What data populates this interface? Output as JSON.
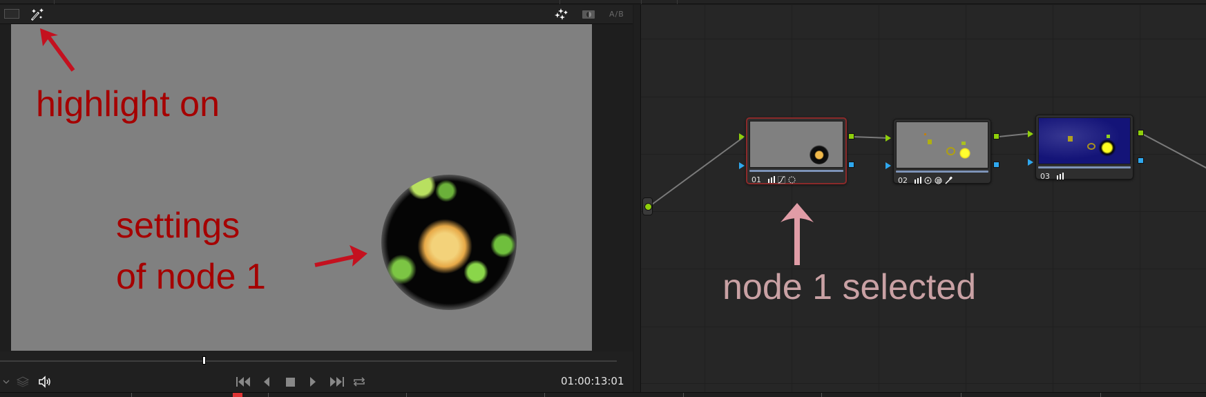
{
  "viewer": {
    "toolbar": {
      "grid_icon": "viewer-grid-icon",
      "highlight_icon": "magic-wand-highlight-icon",
      "effects_icon": "sparkle-icon",
      "split_icon": "split-screen-icon",
      "ab_label": "A/B"
    },
    "annotations": {
      "highlight": "highlight on",
      "settings_line1": "settings",
      "settings_line2": "of node 1"
    },
    "transport": {
      "timecode": "01:00:13:01",
      "buttons": [
        "go-to-start",
        "step-back",
        "stop",
        "play",
        "go-to-end",
        "loop"
      ]
    },
    "annotation_color": "#a50000"
  },
  "node_graph": {
    "nodes": [
      {
        "id": "01",
        "label": "01",
        "selected": true,
        "tools": [
          "primaries-bars",
          "curves",
          "window-circle"
        ]
      },
      {
        "id": "02",
        "label": "02",
        "selected": false,
        "tools": [
          "primaries-bars",
          "window-circle",
          "blur",
          "qualifier-picker"
        ]
      },
      {
        "id": "03",
        "label": "03",
        "selected": false,
        "tools": [
          "primaries-bars"
        ]
      }
    ],
    "annotation": "node 1 selected",
    "annotation_color": "#c9a1a4",
    "colors": {
      "rgb_port": "#8fcf0b",
      "alpha_port": "#2fa8ef",
      "selected_outline": "#8b2a2a"
    }
  }
}
